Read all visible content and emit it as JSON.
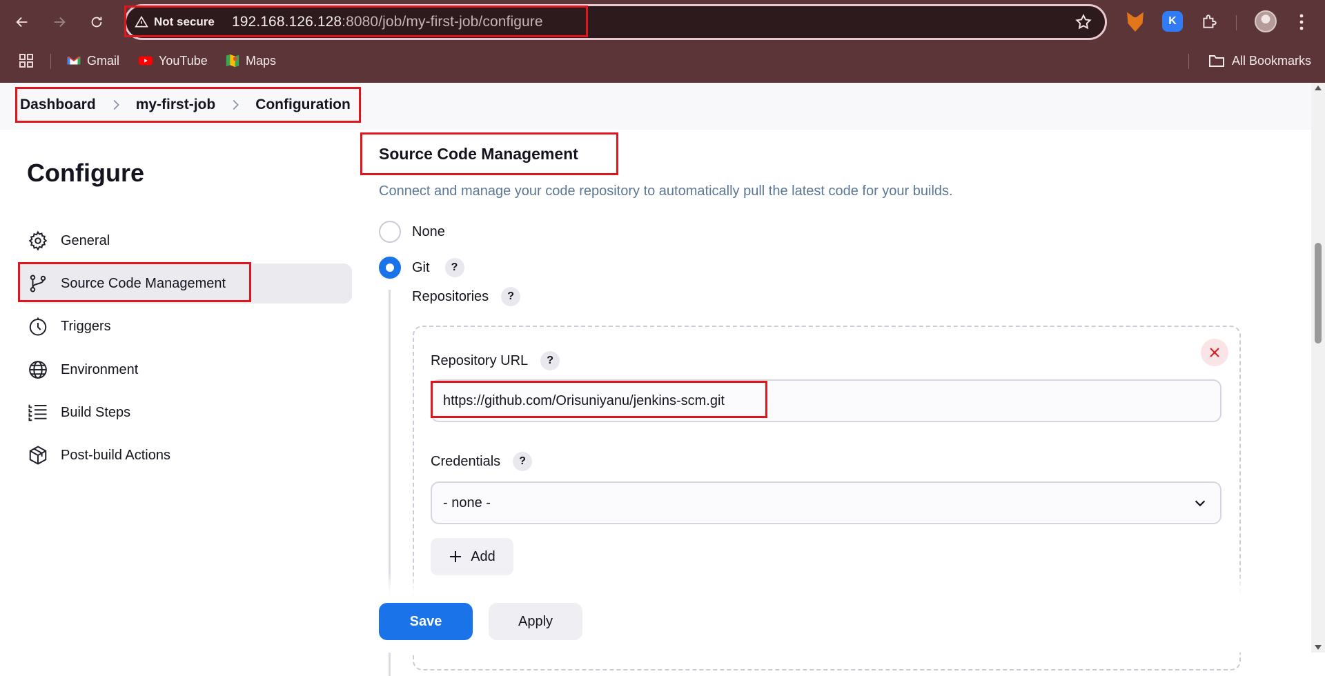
{
  "browser": {
    "security_label": "Not secure",
    "url_host": "192.168.126.128",
    "url_path": ":8080/job/my-first-job/configure",
    "icons": [
      "back-arrow-icon",
      "forward-arrow-icon",
      "reload-icon",
      "warning-icon",
      "star-icon",
      "metamask-icon",
      "extension-k-icon",
      "puzzle-icon",
      "profile-avatar",
      "kebab-menu-icon"
    ]
  },
  "bookmarks": {
    "items": [
      {
        "label": "Gmail",
        "icon": "gmail-icon"
      },
      {
        "label": "YouTube",
        "icon": "youtube-icon"
      },
      {
        "label": "Maps",
        "icon": "maps-icon"
      }
    ],
    "all_label": "All Bookmarks"
  },
  "breadcrumb": [
    "Dashboard",
    "my-first-job",
    "Configuration"
  ],
  "sidebar": {
    "title": "Configure",
    "items": [
      {
        "label": "General",
        "icon": "gear-icon"
      },
      {
        "label": "Source Code Management",
        "icon": "branch-icon",
        "active": true
      },
      {
        "label": "Triggers",
        "icon": "timer-icon"
      },
      {
        "label": "Environment",
        "icon": "globe-icon"
      },
      {
        "label": "Build Steps",
        "icon": "list-icon"
      },
      {
        "label": "Post-build Actions",
        "icon": "package-icon"
      }
    ]
  },
  "main": {
    "section_title": "Source Code Management",
    "section_description": "Connect and manage your code repository to automatically pull the latest code for your builds.",
    "options": [
      {
        "label": "None",
        "selected": false
      },
      {
        "label": "Git",
        "selected": true
      }
    ],
    "help_glyph": "?",
    "repositories_label": "Repositories",
    "repository_url_label": "Repository URL",
    "repository_url_value": "https://github.com/Orisuniyanu/jenkins-scm.git",
    "credentials_label": "Credentials",
    "credentials_value": "- none -",
    "add_label": "Add"
  },
  "actions": {
    "save_label": "Save",
    "apply_label": "Apply"
  },
  "colors": {
    "chrome_bg": "#5b3538",
    "accent_blue": "#1a73e8",
    "annotation_red": "#e0161f",
    "description_text": "#5b7796"
  }
}
